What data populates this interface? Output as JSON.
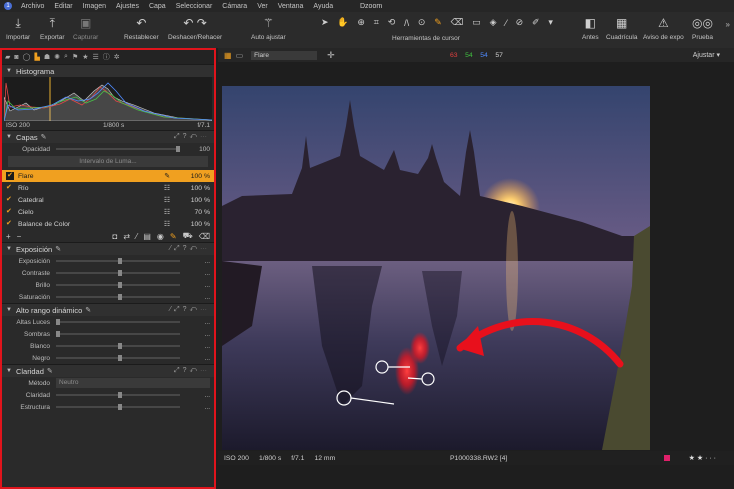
{
  "menu": {
    "items": [
      "Archivo",
      "Editar",
      "Imagen",
      "Ajustes",
      "Capa",
      "Seleccionar",
      "Cámara",
      "Ver",
      "Ventana",
      "Ayuda"
    ],
    "app_title": "Dzoom"
  },
  "toolbar": {
    "importar": "Importar",
    "exportar": "Exportar",
    "capturar": "Capturar",
    "restablecer": "Restablecer",
    "deshacer": "Deshacer/Rehacer",
    "auto_ajustar": "Auto ajustar",
    "herramientas": "Herramientas de cursor",
    "antes": "Antes",
    "cuadricula": "Cuadrícula",
    "aviso": "Aviso de expo",
    "prueba": "Prueba"
  },
  "histogram": {
    "title": "Histograma",
    "iso": "ISO 200",
    "shutter": "1/800 s",
    "aperture": "f/7.1"
  },
  "layers": {
    "title": "Capas",
    "opacity_label": "Opacidad",
    "opacity_value": "100",
    "luma_button": "Intervalo de Luma...",
    "items": [
      {
        "name": "Flare",
        "pct": "100 %",
        "selected": true
      },
      {
        "name": "Río",
        "pct": "100 %",
        "selected": false
      },
      {
        "name": "Catedral",
        "pct": "100 %",
        "selected": false
      },
      {
        "name": "Cielo",
        "pct": "70 %",
        "selected": false
      },
      {
        "name": "Balance de Color",
        "pct": "100 %",
        "selected": false
      }
    ]
  },
  "exposure": {
    "title": "Exposición",
    "rows": [
      "Exposición",
      "Contraste",
      "Brillo",
      "Saturación"
    ]
  },
  "hdr": {
    "title": "Alto rango dinámico",
    "rows": [
      "Altas Luces",
      "Sombras",
      "Blanco",
      "Negro"
    ]
  },
  "clarity": {
    "title": "Claridad",
    "method_label": "Método",
    "method_value": "Neutro",
    "rows": [
      "Claridad",
      "Estructura"
    ]
  },
  "viewer": {
    "layer_select": "Flare",
    "r": "63",
    "g": "54",
    "b": "54",
    "k": "57",
    "adjust_label": "Ajustar",
    "colors": {
      "r": "#e04040",
      "g": "#40c040",
      "b": "#4f8bff",
      "k": "#d0d0d0"
    }
  },
  "footer": {
    "iso": "ISO 200",
    "shutter": "1/800 s",
    "aperture": "f/7.1",
    "focal": "12 mm",
    "filename": "P1000338.RW2 [4]",
    "rating_stars": "★ ★ · · ·"
  },
  "accent": "#f0a020",
  "highlight_border": "#e0141c"
}
